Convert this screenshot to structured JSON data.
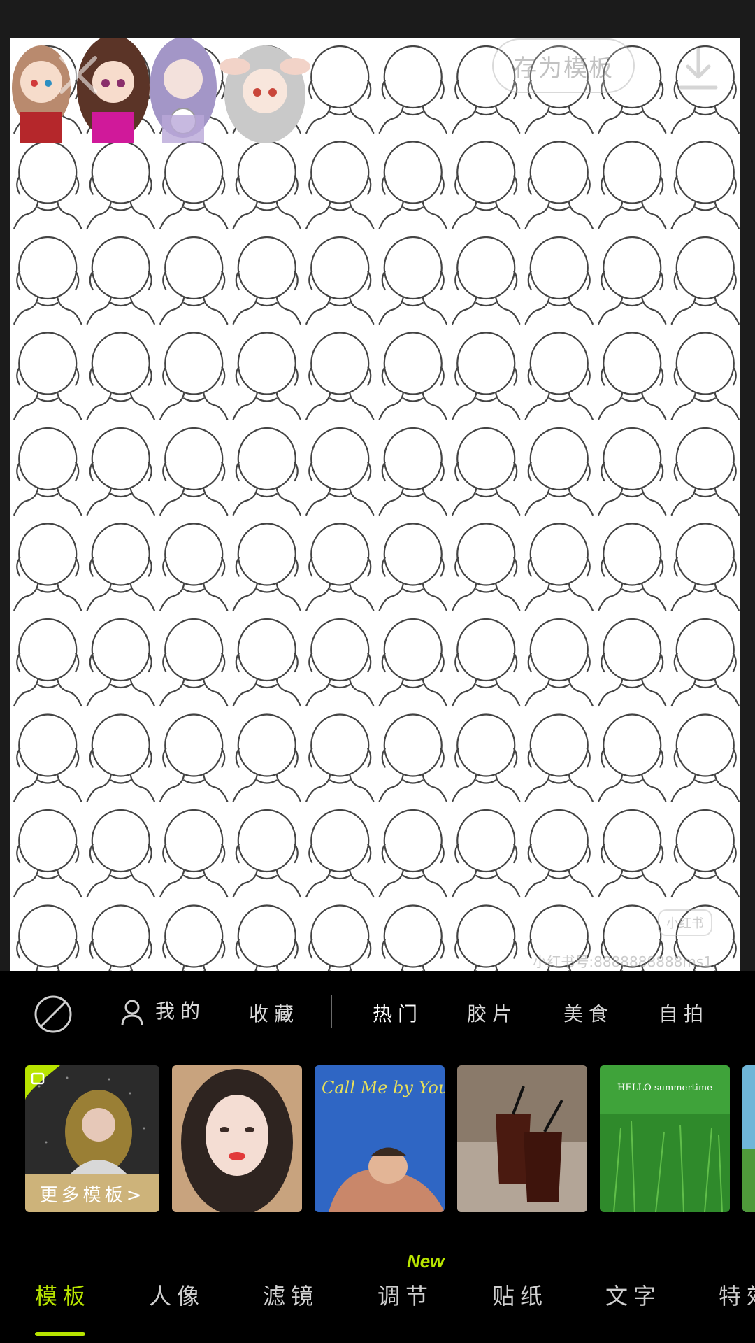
{
  "canvas": {
    "save_template_label": "存为模板",
    "watermark_logo": "小红书",
    "watermark_text": "小红书号:8888888888ms1"
  },
  "categories": {
    "mine": "我的",
    "favorites": "收藏",
    "hot": "热门",
    "film": "胶片",
    "food": "美食",
    "selfie": "自拍"
  },
  "thumbnails": {
    "more_templates": "更多模板>",
    "thumb_3_script": "Call Me by Your Name",
    "thumb_5_text": "HELLO summertime"
  },
  "tabs": {
    "template": "模板",
    "portrait": "人像",
    "filter": "滤镜",
    "adjust": "调节",
    "sticker": "贴纸",
    "text": "文字",
    "effects": "特效",
    "new_badge": "New"
  },
  "colors": {
    "accent": "#b8e400",
    "panel_bg": "#000000",
    "top_bg": "#1b1b1b"
  }
}
